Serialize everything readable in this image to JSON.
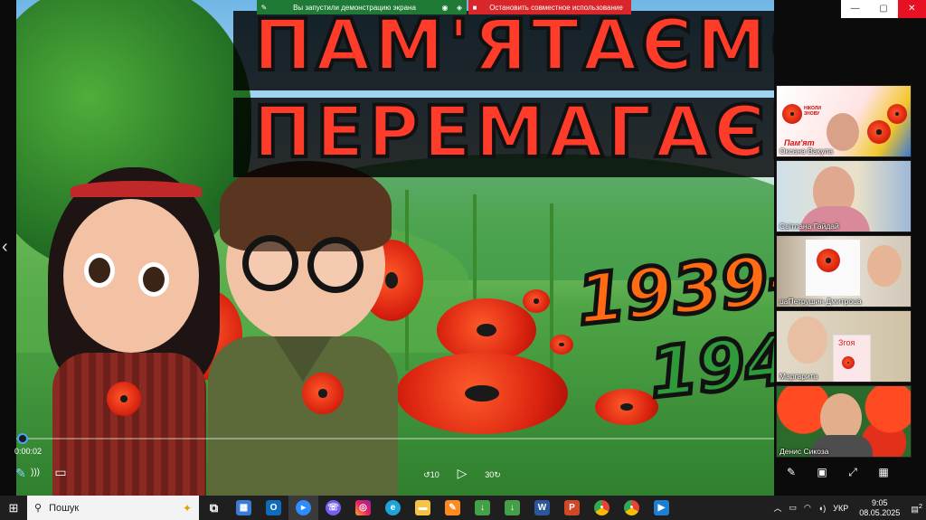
{
  "share_banner": {
    "status_text": "Вы запустили демонстрацию экрана",
    "stop_label": "Остановить совместное использование"
  },
  "slide": {
    "title_line1": "ПАМ'ЯТАЄМО",
    "title_line2": "ПЕРЕМАГАЄМ",
    "year1": "1939-",
    "year2": "194"
  },
  "player": {
    "time": "0:00:02",
    "progress": 0.01,
    "back_label": "10",
    "forward_label": "30"
  },
  "window_controls": {
    "minimize": "—",
    "maximize": "▢",
    "close": "✕"
  },
  "participants": [
    {
      "name": "Оксана Вакула",
      "inset_caption": "Пам'ят",
      "logo_text": "НІКОЛИ ЗНОВУ"
    },
    {
      "name": "Світлана Гайдай"
    },
    {
      "name": "uaПетрушин Дмитроua"
    },
    {
      "name": "Маргарита",
      "paper_text": "Згоя"
    },
    {
      "name": "Денис Сикоза"
    }
  ],
  "taskbar": {
    "search_placeholder": "Пошук",
    "language": "УКР",
    "time": "9:05",
    "date": "08.05.2025",
    "notification_count": "2"
  },
  "colors": {
    "title_red": "#ff3b2a",
    "year_orange": "#ff6a12",
    "year_green": "#2e9a3a",
    "share_green": "#1e7a34",
    "stop_red": "#d9262b"
  }
}
